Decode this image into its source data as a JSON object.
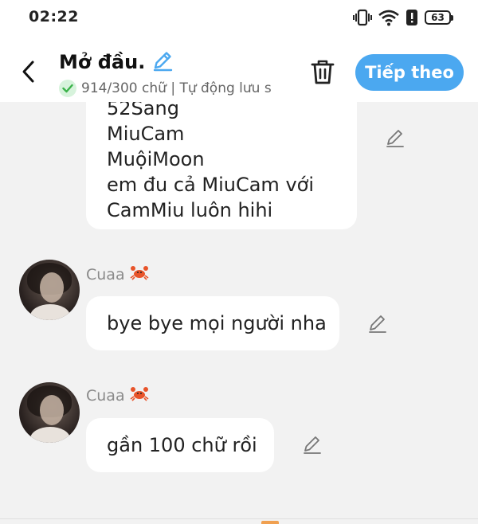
{
  "status_bar": {
    "time": "02:22",
    "battery": "63"
  },
  "app_bar": {
    "title": "Mở đầu.",
    "subtitle": "914/300 chữ | Tự động lưu s",
    "next_label": "Tiếp theo"
  },
  "messages": [
    {
      "lines": [
        "52Sang",
        "MiuCam",
        "MuộiMoon",
        "em đu cả MiuCam với",
        "CamMiu luôn hihi"
      ]
    },
    {
      "author": "Cuaa",
      "text": "bye bye mọi người nha"
    },
    {
      "author": "Cuaa",
      "text": "gần 100 chữ rồi"
    }
  ],
  "colors": {
    "accent": "#4ba8f0",
    "background": "#f2f2f2",
    "check_green": "#3bb34a",
    "crab": "#e8542a"
  }
}
